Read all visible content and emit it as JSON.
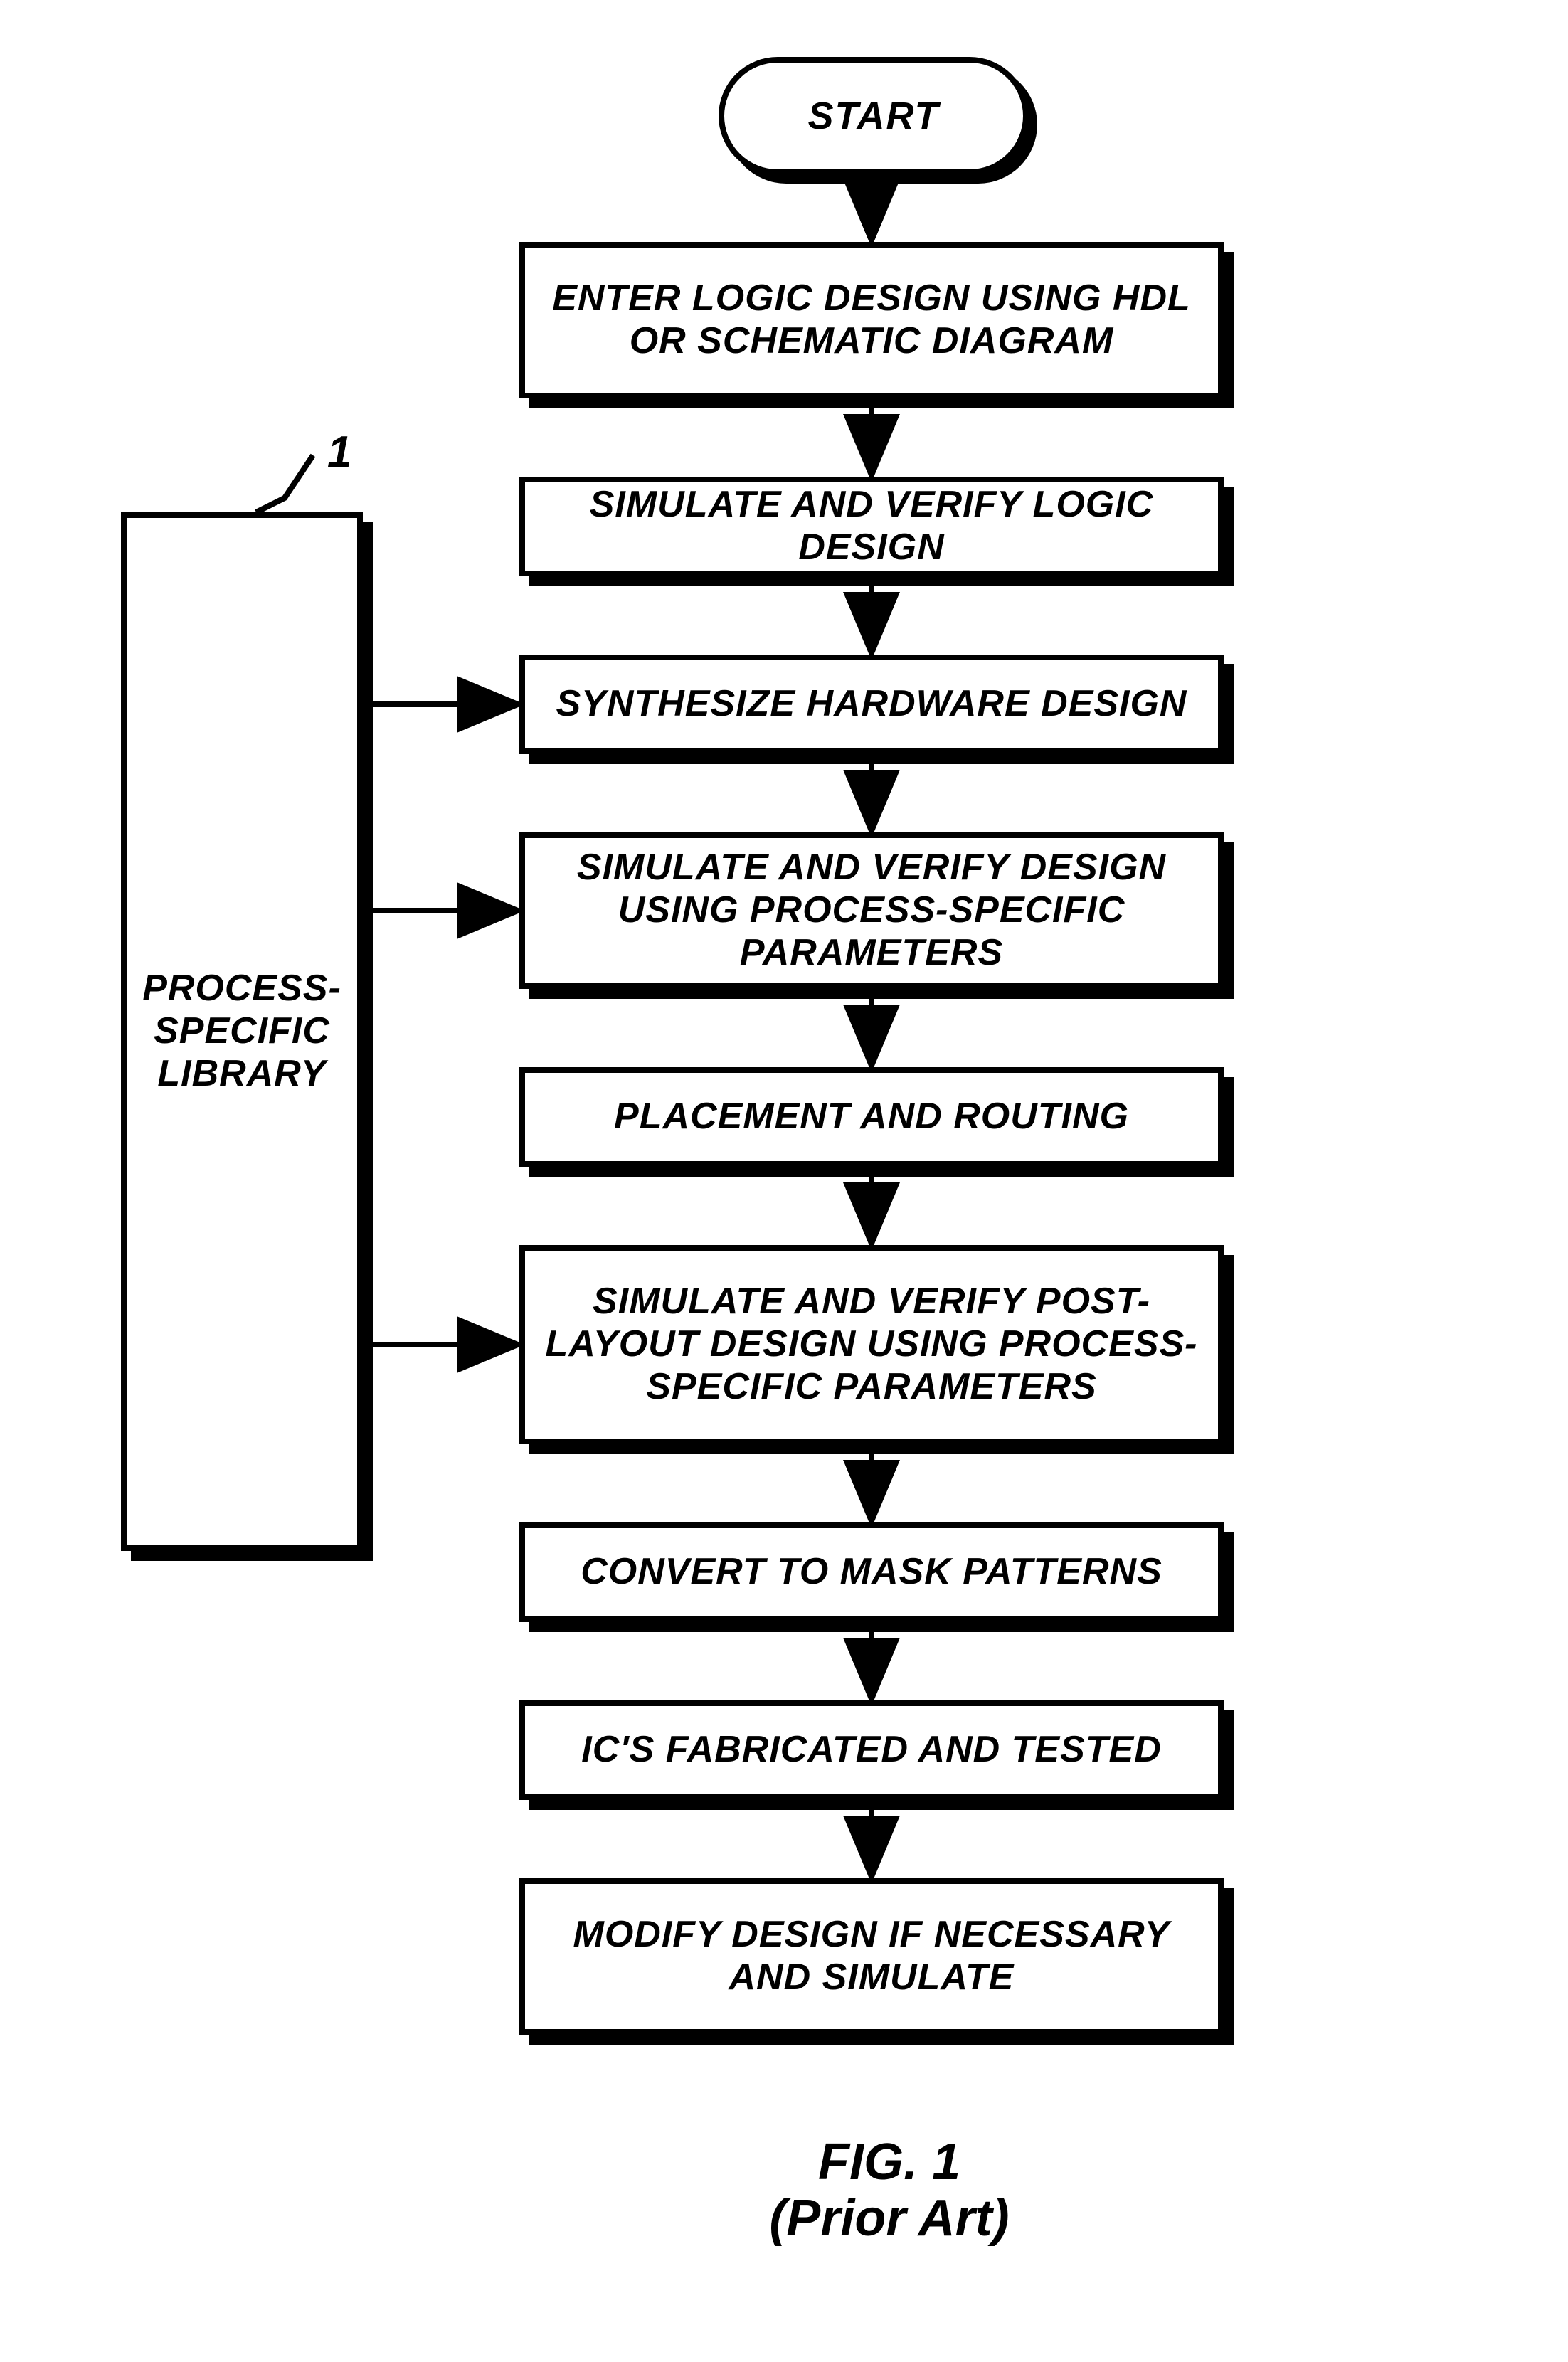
{
  "chart_data": {
    "type": "flowchart",
    "title": "FIG. 1",
    "subtitle": "(Prior Art)",
    "nodes": [
      {
        "id": "start",
        "kind": "terminator",
        "label": "START"
      },
      {
        "id": "enter",
        "kind": "process",
        "label": "ENTER LOGIC DESIGN USING\nHDL OR SCHEMATIC DIAGRAM"
      },
      {
        "id": "simlog",
        "kind": "process",
        "label": "SIMULATE AND VERIFY LOGIC DESIGN"
      },
      {
        "id": "synth",
        "kind": "process",
        "label": "SYNTHESIZE HARDWARE DESIGN"
      },
      {
        "id": "simproc",
        "kind": "process",
        "label": "SIMULATE AND VERIFY DESIGN\nUSING PROCESS-SPECIFIC PARAMETERS"
      },
      {
        "id": "place",
        "kind": "process",
        "label": "PLACEMENT AND ROUTING"
      },
      {
        "id": "simpost",
        "kind": "process",
        "label": "SIMULATE AND VERIFY POST-LAYOUT\nDESIGN USING PROCESS-SPECIFIC\nPARAMETERS"
      },
      {
        "id": "mask",
        "kind": "process",
        "label": "CONVERT TO MASK PATTERNS"
      },
      {
        "id": "fab",
        "kind": "process",
        "label": "IC'S FABRICATED AND TESTED"
      },
      {
        "id": "modify",
        "kind": "process",
        "label": "MODIFY DESIGN IF NECESSARY\nAND SIMULATE"
      },
      {
        "id": "lib",
        "kind": "datastore",
        "label": "PROCESS-\nSPECIFIC\nLIBRARY",
        "ref": "1"
      }
    ],
    "edges": [
      {
        "from": "start",
        "to": "enter"
      },
      {
        "from": "enter",
        "to": "simlog"
      },
      {
        "from": "simlog",
        "to": "synth"
      },
      {
        "from": "synth",
        "to": "simproc"
      },
      {
        "from": "simproc",
        "to": "place"
      },
      {
        "from": "place",
        "to": "simpost"
      },
      {
        "from": "simpost",
        "to": "mask"
      },
      {
        "from": "mask",
        "to": "fab"
      },
      {
        "from": "fab",
        "to": "modify"
      },
      {
        "from": "lib",
        "to": "synth"
      },
      {
        "from": "lib",
        "to": "simproc"
      },
      {
        "from": "lib",
        "to": "simpost"
      }
    ]
  },
  "start_label": "START",
  "steps": {
    "enter": "ENTER LOGIC DESIGN USING HDL OR SCHEMATIC DIAGRAM",
    "simlog": "SIMULATE AND VERIFY LOGIC DESIGN",
    "synth": "SYNTHESIZE HARDWARE DESIGN",
    "simproc": "SIMULATE AND VERIFY DESIGN USING PROCESS-SPECIFIC PARAMETERS",
    "place": "PLACEMENT AND ROUTING",
    "simpost": "SIMULATE AND VERIFY POST-LAYOUT DESIGN USING PROCESS-SPECIFIC PARAMETERS",
    "mask": "CONVERT TO MASK PATTERNS",
    "fab": "IC'S FABRICATED AND TESTED",
    "modify": "MODIFY DESIGN IF NECESSARY AND SIMULATE"
  },
  "library_label": "PROCESS- SPECIFIC LIBRARY",
  "library_ref": "1",
  "caption_line1": "FIG. 1",
  "caption_line2": "(Prior Art)"
}
